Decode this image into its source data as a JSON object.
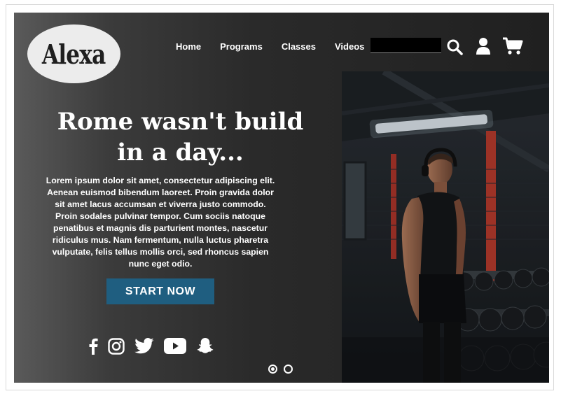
{
  "brand": {
    "logo_text": "Alexa"
  },
  "nav": {
    "items": [
      {
        "label": "Home"
      },
      {
        "label": "Programs"
      },
      {
        "label": "Classes"
      },
      {
        "label": "Videos"
      }
    ]
  },
  "search": {
    "value": "",
    "placeholder": ""
  },
  "icons": {
    "search": "search-icon",
    "user": "user-icon",
    "cart": "cart-icon"
  },
  "hero": {
    "headline_line1": "Rome wasn't build",
    "headline_line2": "in a day...",
    "body": "Lorem ipsum dolor sit amet, consectetur adipiscing elit. Aenean euismod bibendum laoreet. Proin gravida dolor sit amet lacus accumsan et viverra justo commodo. Proin sodales pulvinar tempor. Cum sociis natoque penatibus et magnis dis parturient montes, nascetur ridiculus mus. Nam fermentum, nulla luctus pharetra vulputate, felis tellus mollis orci, sed rhoncus sapien nunc eget odio.",
    "cta_label": "START NOW"
  },
  "socials": [
    "facebook-icon",
    "instagram-icon",
    "twitter-icon",
    "youtube-icon",
    "snapchat-icon"
  ],
  "carousel": {
    "slide_count": 2,
    "active_index": 0
  },
  "colors": {
    "cta": "#1f5e80",
    "hero_bg": "#2a2a2a",
    "accent_red": "#c0392b"
  }
}
